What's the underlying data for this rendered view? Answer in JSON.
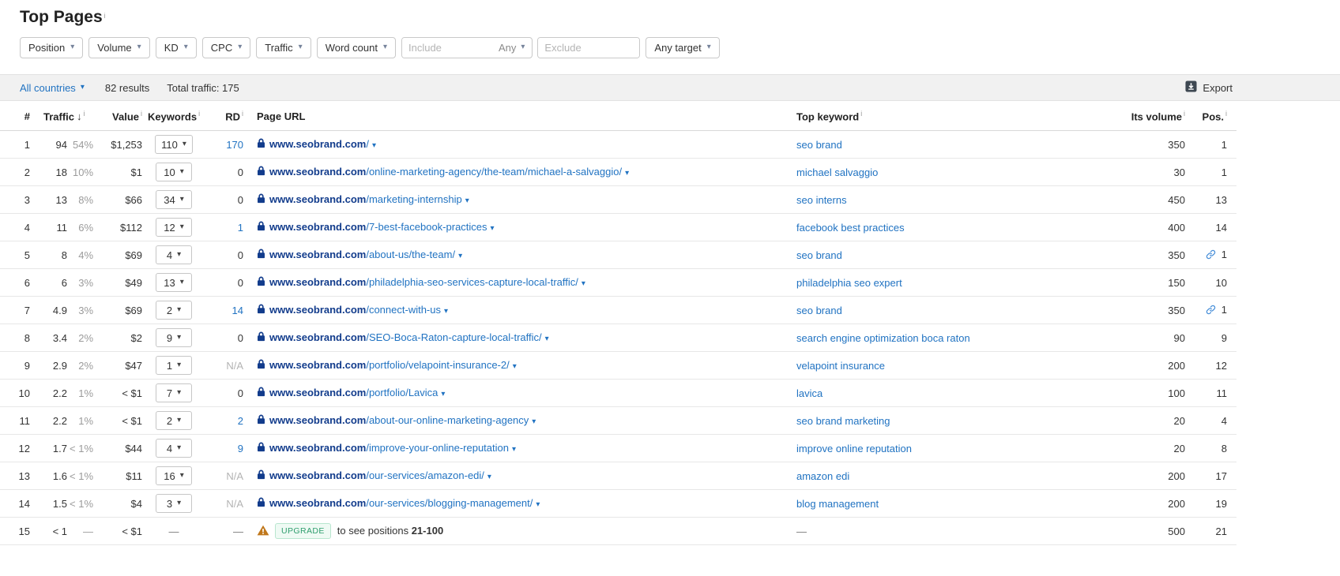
{
  "page": {
    "title": "Top Pages"
  },
  "icons": {
    "caret": "▾",
    "sort_desc": "↓",
    "info": "i",
    "dash": "—"
  },
  "filters": {
    "dropdowns": [
      "Position",
      "Volume",
      "KD",
      "CPC",
      "Traffic",
      "Word count"
    ],
    "include_placeholder": "Include",
    "include_mode": "Any",
    "exclude_placeholder": "Exclude",
    "target": "Any target"
  },
  "infobar": {
    "country_selector": "All countries",
    "results": "82 results",
    "total_traffic": "Total traffic: 175",
    "export_label": "Export"
  },
  "table": {
    "columns": {
      "num": "#",
      "traffic": "Traffic",
      "value": "Value",
      "keywords": "Keywords",
      "rd": "RD",
      "page_url": "Page URL",
      "top_keyword": "Top keyword",
      "its_volume": "Its volume",
      "pos": "Pos."
    }
  },
  "rows": [
    {
      "num": "1",
      "traffic": "94",
      "traffic_pct": "54%",
      "value": "$1,253",
      "keywords": "110",
      "rd": "170",
      "rd_style": "link",
      "url_domain": "www.seobrand.com",
      "url_path": "/",
      "top_keyword": "seo brand",
      "volume": "350",
      "pos": "1",
      "pos_link": false
    },
    {
      "num": "2",
      "traffic": "18",
      "traffic_pct": "10%",
      "value": "$1",
      "keywords": "10",
      "rd": "0",
      "rd_style": "plain",
      "url_domain": "www.seobrand.com",
      "url_path": "/online-marketing-agency/the-team/michael-a-salvaggio/",
      "top_keyword": "michael salvaggio",
      "volume": "30",
      "pos": "1",
      "pos_link": false
    },
    {
      "num": "3",
      "traffic": "13",
      "traffic_pct": "8%",
      "value": "$66",
      "keywords": "34",
      "rd": "0",
      "rd_style": "plain",
      "url_domain": "www.seobrand.com",
      "url_path": "/marketing-internship",
      "top_keyword": "seo interns",
      "volume": "450",
      "pos": "13",
      "pos_link": false
    },
    {
      "num": "4",
      "traffic": "11",
      "traffic_pct": "6%",
      "value": "$112",
      "keywords": "12",
      "rd": "1",
      "rd_style": "link",
      "url_domain": "www.seobrand.com",
      "url_path": "/7-best-facebook-practices",
      "top_keyword": "facebook best practices",
      "volume": "400",
      "pos": "14",
      "pos_link": false
    },
    {
      "num": "5",
      "traffic": "8",
      "traffic_pct": "4%",
      "value": "$69",
      "keywords": "4",
      "rd": "0",
      "rd_style": "plain",
      "url_domain": "www.seobrand.com",
      "url_path": "/about-us/the-team/",
      "top_keyword": "seo brand",
      "volume": "350",
      "pos": "1",
      "pos_link": true
    },
    {
      "num": "6",
      "traffic": "6",
      "traffic_pct": "3%",
      "value": "$49",
      "keywords": "13",
      "rd": "0",
      "rd_style": "plain",
      "url_domain": "www.seobrand.com",
      "url_path": "/philadelphia-seo-services-capture-local-traffic/",
      "top_keyword": "philadelphia seo expert",
      "volume": "150",
      "pos": "10",
      "pos_link": false
    },
    {
      "num": "7",
      "traffic": "4.9",
      "traffic_pct": "3%",
      "value": "$69",
      "keywords": "2",
      "rd": "14",
      "rd_style": "link",
      "url_domain": "www.seobrand.com",
      "url_path": "/connect-with-us",
      "top_keyword": "seo brand",
      "volume": "350",
      "pos": "1",
      "pos_link": true
    },
    {
      "num": "8",
      "traffic": "3.4",
      "traffic_pct": "2%",
      "value": "$2",
      "keywords": "9",
      "rd": "0",
      "rd_style": "plain",
      "url_domain": "www.seobrand.com",
      "url_path": "/SEO-Boca-Raton-capture-local-traffic/",
      "top_keyword": "search engine optimization boca raton",
      "volume": "90",
      "pos": "9",
      "pos_link": false
    },
    {
      "num": "9",
      "traffic": "2.9",
      "traffic_pct": "2%",
      "value": "$47",
      "keywords": "1",
      "rd": "N/A",
      "rd_style": "na",
      "url_domain": "www.seobrand.com",
      "url_path": "/portfolio/velapoint-insurance-2/",
      "top_keyword": "velapoint insurance",
      "volume": "200",
      "pos": "12",
      "pos_link": false
    },
    {
      "num": "10",
      "traffic": "2.2",
      "traffic_pct": "1%",
      "value": "< $1",
      "keywords": "7",
      "rd": "0",
      "rd_style": "plain",
      "url_domain": "www.seobrand.com",
      "url_path": "/portfolio/Lavica",
      "top_keyword": "lavica",
      "volume": "100",
      "pos": "11",
      "pos_link": false
    },
    {
      "num": "11",
      "traffic": "2.2",
      "traffic_pct": "1%",
      "value": "< $1",
      "keywords": "2",
      "rd": "2",
      "rd_style": "link",
      "url_domain": "www.seobrand.com",
      "url_path": "/about-our-online-marketing-agency",
      "top_keyword": "seo brand marketing",
      "volume": "20",
      "pos": "4",
      "pos_link": false
    },
    {
      "num": "12",
      "traffic": "1.7",
      "traffic_pct": "< 1%",
      "value": "$44",
      "keywords": "4",
      "rd": "9",
      "rd_style": "link",
      "url_domain": "www.seobrand.com",
      "url_path": "/improve-your-online-reputation",
      "top_keyword": "improve online reputation",
      "volume": "20",
      "pos": "8",
      "pos_link": false
    },
    {
      "num": "13",
      "traffic": "1.6",
      "traffic_pct": "< 1%",
      "value": "$11",
      "keywords": "16",
      "rd": "N/A",
      "rd_style": "na",
      "url_domain": "www.seobrand.com",
      "url_path": "/our-services/amazon-edi/",
      "top_keyword": "amazon edi",
      "volume": "200",
      "pos": "17",
      "pos_link": false
    },
    {
      "num": "14",
      "traffic": "1.5",
      "traffic_pct": "< 1%",
      "value": "$4",
      "keywords": "3",
      "rd": "N/A",
      "rd_style": "na",
      "url_domain": "www.seobrand.com",
      "url_path": "/our-services/blogging-management/",
      "top_keyword": "blog management",
      "volume": "200",
      "pos": "19",
      "pos_link": false
    },
    {
      "num": "15",
      "traffic": "< 1",
      "traffic_pct": "—",
      "value": "< $1",
      "keywords": "—",
      "rd": "—",
      "rd_style": "dash",
      "upgrade": {
        "badge": "UPGRADE",
        "text_before": "to see positions ",
        "range": "21-100"
      },
      "top_keyword": "—",
      "volume": "500",
      "pos": "21",
      "pos_link": false
    }
  ]
}
